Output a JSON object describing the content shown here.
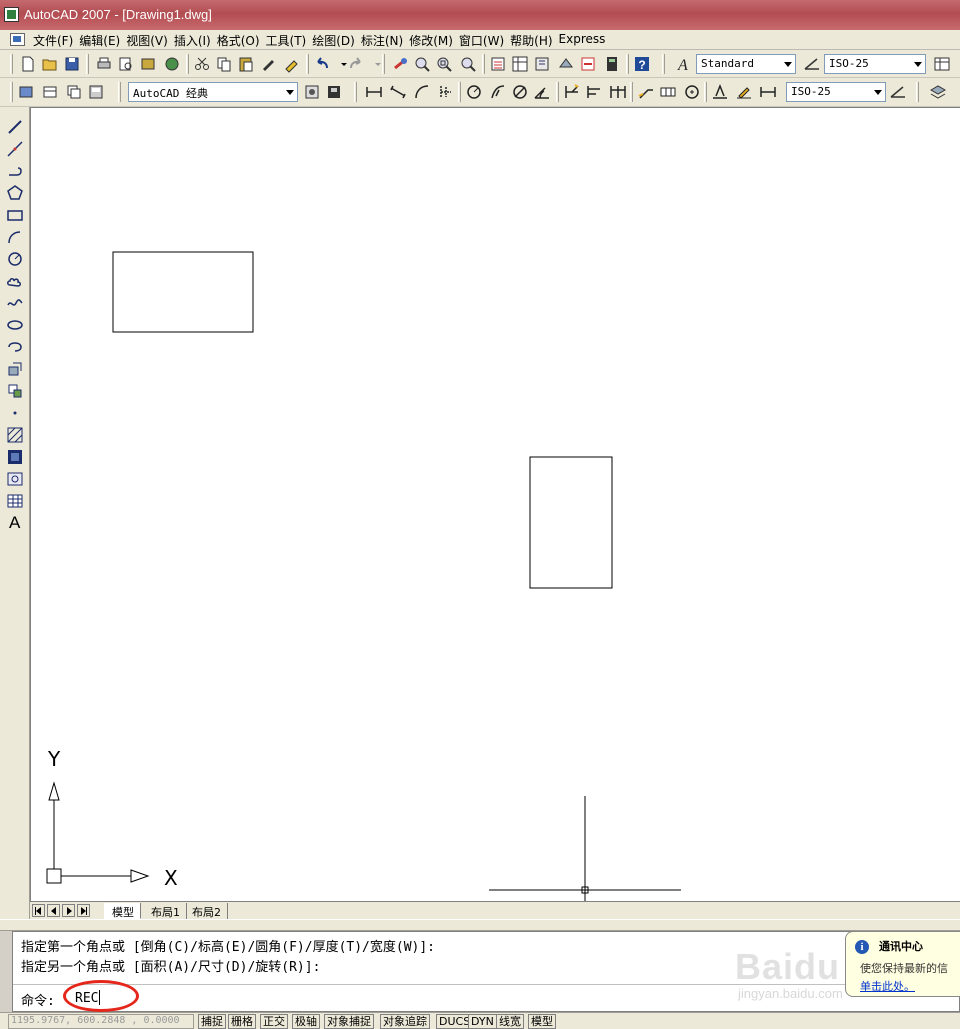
{
  "window": {
    "title": "AutoCAD 2007 - [Drawing1.dwg]"
  },
  "menu": {
    "items": [
      "文件(F)",
      "编辑(E)",
      "视图(V)",
      "插入(I)",
      "格式(O)",
      "工具(T)",
      "绘图(D)",
      "标注(N)",
      "修改(M)",
      "窗口(W)",
      "帮助(H)",
      "Express"
    ]
  },
  "toolbar": {
    "text_style": "Standard",
    "dim_style_top": "ISO-25",
    "workspace": "AutoCAD 经典",
    "dim_style_bottom": "ISO-25"
  },
  "draw_toolbar": {
    "text_tool": "A"
  },
  "ucs": {
    "x_label": "X",
    "y_label": "Y"
  },
  "layout_tabs": [
    "模型",
    "布局1",
    "布局2"
  ],
  "command": {
    "line1": "指定第一个角点或 [倒角(C)/标高(E)/圆角(F)/厚度(T)/宽度(W)]:",
    "line2": "指定另一个角点或 [面积(A)/尺寸(D)/旋转(R)]:",
    "prompt": "命令:",
    "input": "REC"
  },
  "notification": {
    "title": "通讯中心",
    "body": "使您保持最新的信",
    "link": "单击此处。"
  },
  "watermark": {
    "brand": "Baidu",
    "site": "jingyan.baidu.com"
  },
  "status": {
    "coordinates": "1195.9767, 600.2848 , 0.0000",
    "buttons": [
      "捕捉",
      "栅格",
      "正交",
      "极轴",
      "对象捕捉",
      "对象追踪",
      "DUCS",
      "DYN",
      "线宽",
      "模型"
    ]
  },
  "colors": {
    "title_bar": "#b24d52",
    "highlight": "#e5261a",
    "canvas": "#ffffff"
  }
}
